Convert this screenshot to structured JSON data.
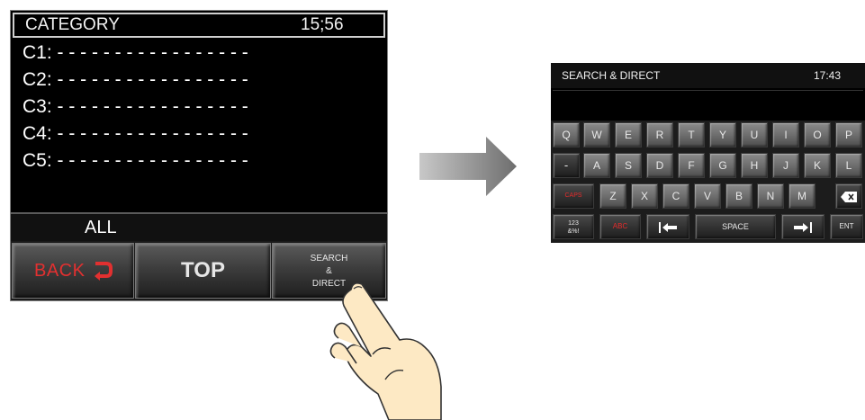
{
  "screen1": {
    "title": "CATEGORY",
    "time": "15;56",
    "categories": [
      {
        "label": "C1:",
        "value": "- - - - - - - - - - - - - - - - -"
      },
      {
        "label": "C2:",
        "value": "- - - - - - - - - - - - - - - - -"
      },
      {
        "label": "C3:",
        "value": "- - - - - - - - - - - - - - - - -"
      },
      {
        "label": "C4:",
        "value": "- - - - - - - - - - - - - - - - -"
      },
      {
        "label": "C5:",
        "value": "- - - - - - - - - - - - - - - - -"
      }
    ],
    "filter_label": "ALL",
    "buttons": {
      "back": "BACK",
      "top": "TOP",
      "search_line1": "SEARCH",
      "search_line2": "&",
      "search_line3": "DIRECT"
    }
  },
  "screen2": {
    "title": "SEARCH & DIRECT",
    "time": "17:43",
    "input_value": "",
    "keyboard": {
      "row1": [
        "Q",
        "W",
        "E",
        "R",
        "T",
        "Y",
        "U",
        "I",
        "O",
        "P"
      ],
      "row2": [
        "-",
        "A",
        "S",
        "D",
        "F",
        "G",
        "H",
        "J",
        "K",
        "L"
      ],
      "row3": [
        "CAPS",
        "Z",
        "X",
        "C",
        "V",
        "B",
        "N",
        "M"
      ],
      "row4": {
        "num_top": "123",
        "num_bottom": "&%!",
        "abc": "ABC",
        "space": "SPACE",
        "enter": "ENT"
      }
    }
  },
  "colors": {
    "accent_red": "#e23030",
    "screen_bg": "#000000",
    "arrow": "#7a7a7a"
  },
  "icons": [
    "back-arrow-icon",
    "hand-pointer-icon",
    "transition-arrow-icon",
    "backspace-icon",
    "cursor-left-icon",
    "cursor-right-icon"
  ]
}
